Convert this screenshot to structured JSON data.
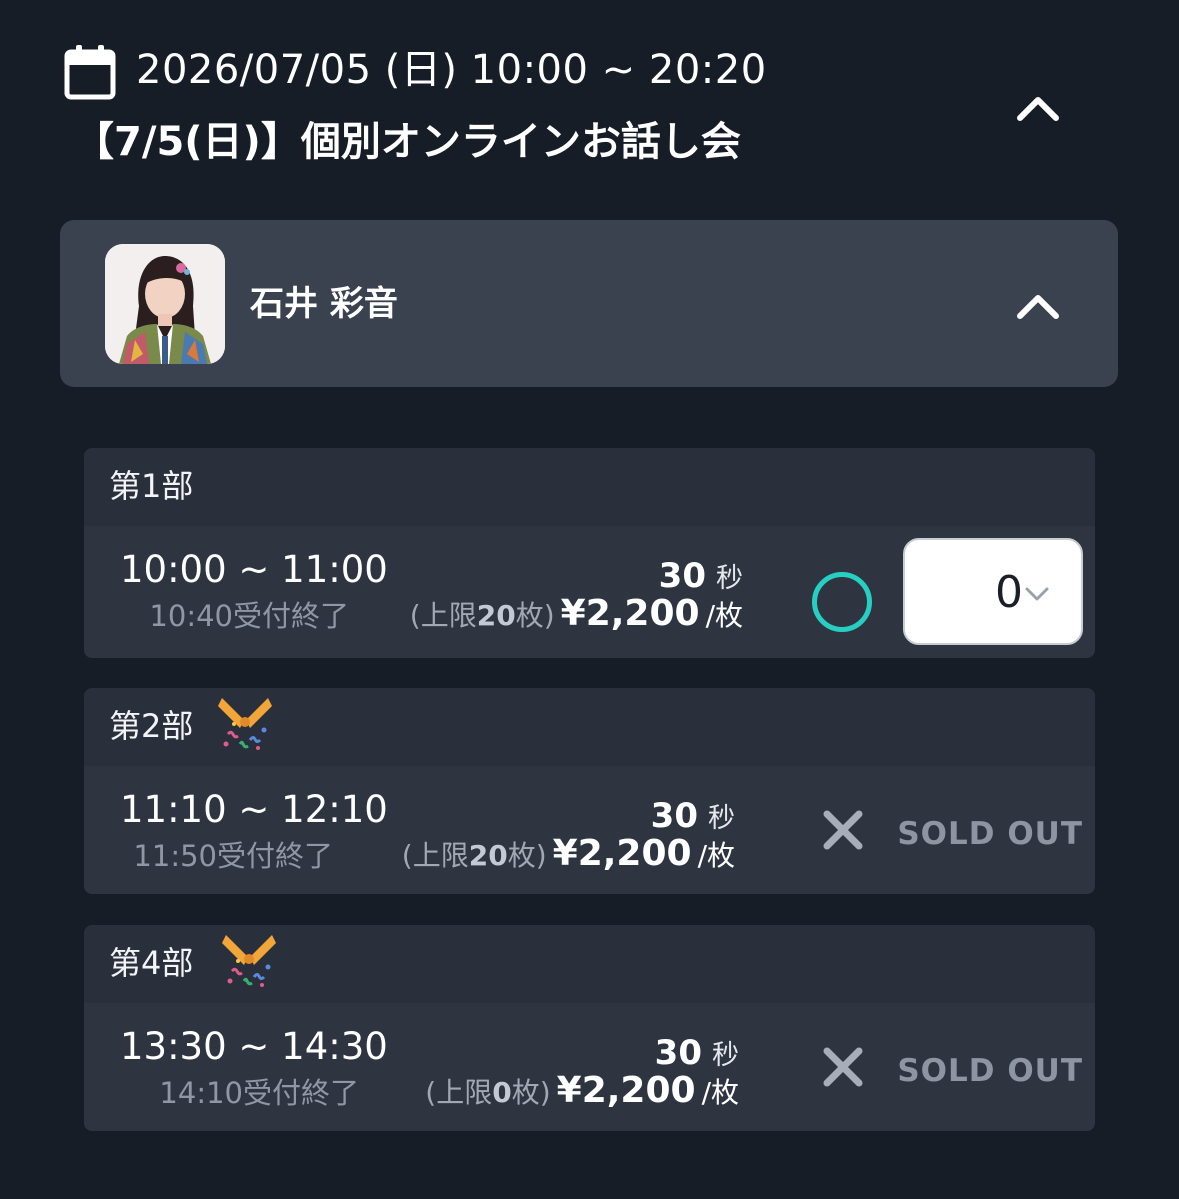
{
  "event": {
    "date_range": "2026/07/05 (日) 10:00 ~ 20:20",
    "title": "【7/5(日)】個別オンラインお話し会",
    "calendar_icon": "calendar-icon",
    "collapse_icon": "chevron-up-icon"
  },
  "member": {
    "name": "石井 彩音",
    "avatar_icon": "avatar",
    "collapse_icon": "chevron-up-icon"
  },
  "slots": [
    {
      "name": "第1部",
      "party_icon": null,
      "time": "10:00 ~ 11:00",
      "deadline": "10:40受付終了",
      "duration_num": "30",
      "duration_unit": "秒",
      "limit_prefix": "(上限",
      "limit_num": "20",
      "limit_suffix": "枚)",
      "price": "¥2,200",
      "per": "/枚",
      "status": "available",
      "status_icon": "circle-available-icon",
      "quantity": "0"
    },
    {
      "name": "第2部",
      "party_icon": "party-popper-icon",
      "time": "11:10 ~ 12:10",
      "deadline": "11:50受付終了",
      "duration_num": "30",
      "duration_unit": "秒",
      "limit_prefix": "(上限",
      "limit_num": "20",
      "limit_suffix": "枚)",
      "price": "¥2,200",
      "per": "/枚",
      "status": "sold_out",
      "status_icon": "cross-icon",
      "status_label": "SOLD OUT"
    },
    {
      "name": "第4部",
      "party_icon": "party-popper-icon",
      "time": "13:30 ~ 14:30",
      "deadline": "14:10受付終了",
      "duration_num": "30",
      "duration_unit": "秒",
      "limit_prefix": "(上限",
      "limit_num": "0",
      "limit_suffix": "枚)",
      "price": "¥2,200",
      "per": "/枚",
      "status": "sold_out",
      "status_icon": "cross-icon",
      "status_label": "SOLD OUT"
    }
  ],
  "colors": {
    "background": "#171d26",
    "card": "#3a414f",
    "slot_header": "#2a303b",
    "slot_body": "#2e3541",
    "available_accent": "#27cfc3",
    "sold_out_text": "#8d95a3"
  }
}
